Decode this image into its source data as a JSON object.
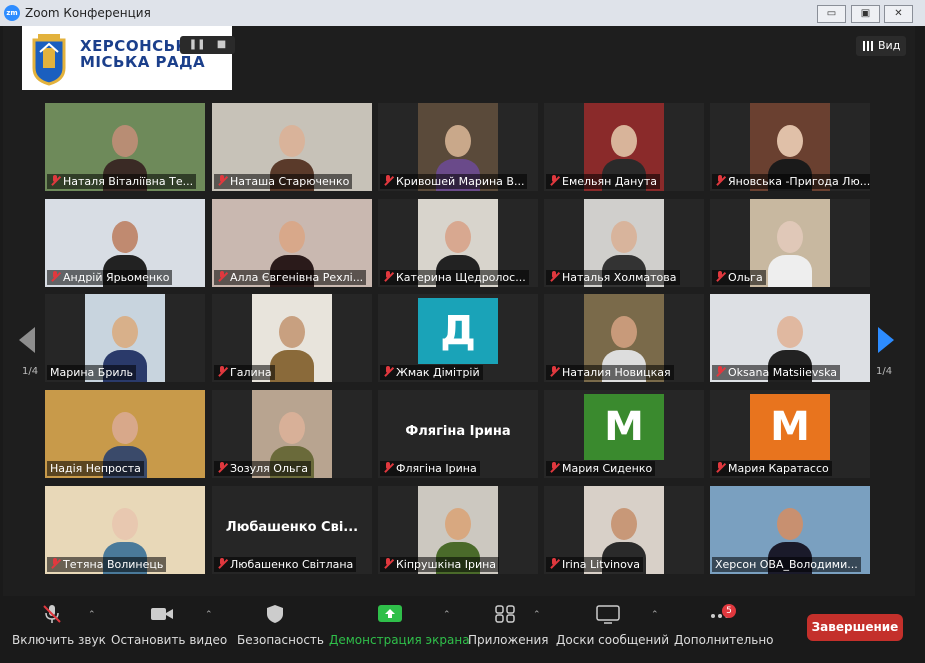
{
  "window": {
    "title": "Zoom Конференция",
    "app_icon": "zm",
    "controls": [
      "minimize-icon",
      "maximize-icon",
      "close-icon"
    ]
  },
  "logo": {
    "line1": "ХЕРСОНСЬКА",
    "line2": "МІСЬКА РАДА"
  },
  "recording": {
    "pause_icon": "pause-icon",
    "stop_icon": "stop-icon"
  },
  "view_button": {
    "label": "Вид",
    "icon": "grid-icon"
  },
  "pager": {
    "left": "1/4",
    "right": "1/4"
  },
  "participants": [
    {
      "label": "Наталя Віталіївна Те...",
      "video": true
    },
    {
      "label": "Наташа Старюченко",
      "video": true
    },
    {
      "label": "Кривошей Марина В...",
      "video": true
    },
    {
      "label": "Емельян Данута",
      "video": true
    },
    {
      "label": "Яновська -Пригода Лю...",
      "video": true
    },
    {
      "label": "Андрій Ярьоменко",
      "video": true
    },
    {
      "label": "Алла Євгенівна Рехлі...",
      "video": true
    },
    {
      "label": "Катерина Щедролос...",
      "video": true
    },
    {
      "label": "Наталья Холматова",
      "video": true
    },
    {
      "label": "Ольга",
      "video": true
    },
    {
      "label": "Марина Бриль",
      "video": true,
      "muted": false
    },
    {
      "label": "Галина",
      "video": true
    },
    {
      "label": "Жмак Дімітрій",
      "video": false,
      "avatar": "Д",
      "avatar_color": "#1aa3b8"
    },
    {
      "label": "Наталия Новицкая",
      "video": true
    },
    {
      "label": "Oksana Matsiievska",
      "video": true
    },
    {
      "label": "Надія  Непроста",
      "video": true,
      "muted": false
    },
    {
      "label": "Зозуля Ольга",
      "video": true
    },
    {
      "label": "Флягіна Ірина",
      "video": false,
      "name_text": "Флягіна Ірина"
    },
    {
      "label": "Мария Сиденко",
      "video": false,
      "avatar": "M",
      "avatar_color": "#3a8a2e"
    },
    {
      "label": "Мария Каратассо",
      "video": false,
      "avatar": "M",
      "avatar_color": "#e8741e"
    },
    {
      "label": "Тетяна Волинець",
      "video": true
    },
    {
      "label": "Любашенко Світлана",
      "video": false,
      "name_text": "Любашенко  Сві..."
    },
    {
      "label": "Кіпрушкіна Ірина",
      "video": true
    },
    {
      "label": "Irina Litvinova",
      "video": true
    },
    {
      "label": "Херсон ОВА_Володими...",
      "video": true,
      "active": true,
      "muted": false
    }
  ],
  "toolbar": {
    "audio": "Включить звук",
    "video": "Остановить видео",
    "security": "Безопасность",
    "share": "Демонстрация экрана",
    "apps": "Приложения",
    "whiteboards": "Доски сообщений",
    "more": "Дополнительно",
    "more_badge": "5",
    "end": "Завершение"
  },
  "colors": {
    "share_green": "#2fbf4a",
    "end_red": "#c4302b",
    "accent_blue": "#2d8cff",
    "active_border": "#cbe28a"
  }
}
